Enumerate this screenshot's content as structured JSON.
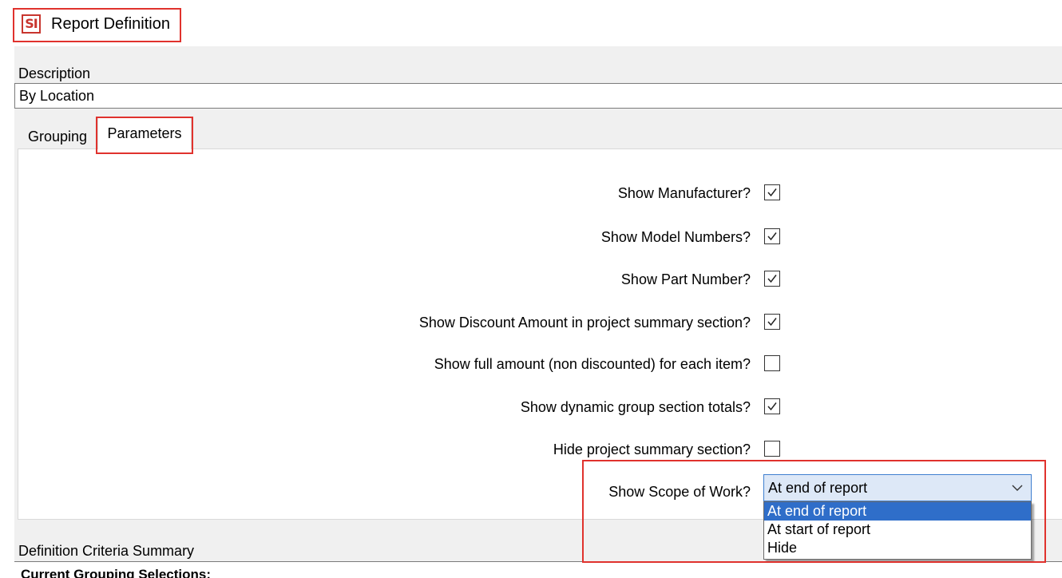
{
  "window": {
    "title": "Report Definition",
    "app_icon_text": "SI"
  },
  "description": {
    "label": "Description",
    "value": "By Location"
  },
  "tabs": [
    {
      "label": "Grouping",
      "active": false
    },
    {
      "label": "Parameters",
      "active": true
    }
  ],
  "parameters": [
    {
      "label": "Show Manufacturer?",
      "checked": true
    },
    {
      "label": "Show Model Numbers?",
      "checked": true
    },
    {
      "label": "Show Part Number?",
      "checked": true
    },
    {
      "label": "Show Discount Amount in project summary section?",
      "checked": true
    },
    {
      "label": "Show full amount (non discounted) for each item?",
      "checked": false
    },
    {
      "label": "Show dynamic group section totals?",
      "checked": true
    },
    {
      "label": "Hide project summary section?",
      "checked": false
    }
  ],
  "scope_of_work": {
    "label": "Show Scope of Work?",
    "selected": "At end of report",
    "options": [
      "At end of report",
      "At start of report",
      "Hide"
    ]
  },
  "summary": {
    "label": "Definition Criteria Summary",
    "text": "Current Grouping Selections:"
  },
  "colors": {
    "highlight": "#e0322d",
    "selection": "#2f6ec9",
    "panel": "#f0f0f0"
  }
}
